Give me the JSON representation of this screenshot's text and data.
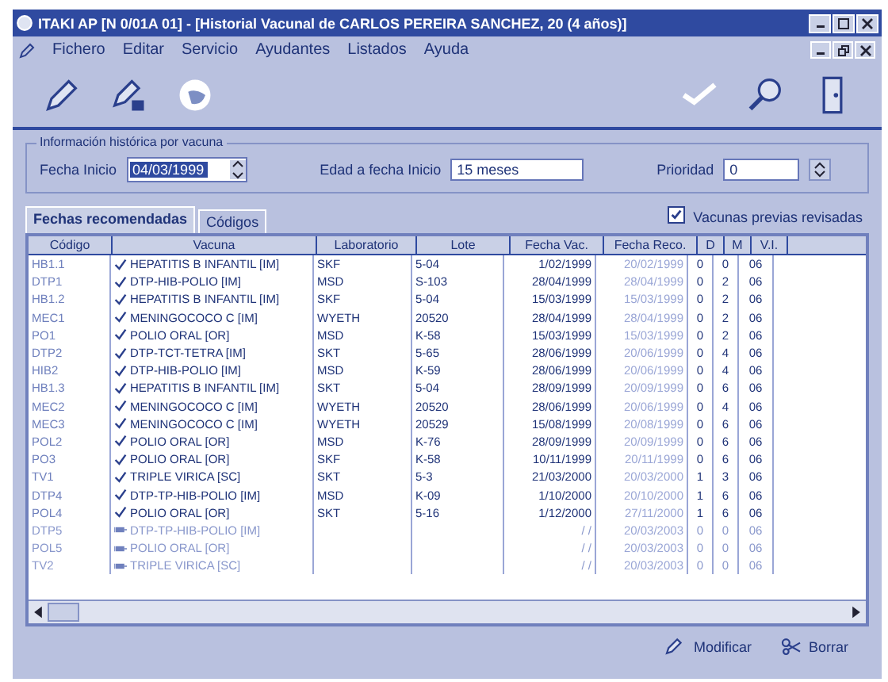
{
  "window": {
    "title": "ITAKI AP [N 0/01A 01] - [Historial Vacunal de CARLOS PEREIRA SANCHEZ, 20 (4 años)]"
  },
  "menu": [
    "Fichero",
    "Editar",
    "Servicio",
    "Ayudantes",
    "Listados",
    "Ayuda"
  ],
  "filter": {
    "title": "Información histórica por vacuna",
    "start_label": "Fecha Inicio",
    "start_value": "04/03/1999",
    "age_label": "Edad a fecha Inicio",
    "age_value": "15 meses",
    "priority_label": "Prioridad",
    "priority_value": "0"
  },
  "tabs": [
    {
      "label": "Fechas recomendadas",
      "selected": true
    },
    {
      "label": "Códigos",
      "selected": false
    }
  ],
  "reviewed": {
    "label": "Vacunas previas revisadas",
    "checked": true
  },
  "table": {
    "columns": [
      "Código",
      "Vacuna",
      "Laboratorio",
      "Lote",
      "Fecha Vac.",
      "Fecha Reco.",
      "D",
      "M",
      "V.I."
    ],
    "rows": [
      {
        "kind": "given",
        "cells": [
          "HB1.1",
          "HEPATITIS B INFANTIL [IM]",
          "SKF",
          "5-04",
          "1/02/1999",
          "20/02/1999",
          "0",
          "0",
          "06"
        ]
      },
      {
        "kind": "given",
        "cells": [
          "DTP1",
          "DTP-HIB-POLIO [IM]",
          "MSD",
          "S-103",
          "28/04/1999",
          "28/04/1999",
          "0",
          "2",
          "06"
        ]
      },
      {
        "kind": "given",
        "cells": [
          "HB1.2",
          "HEPATITIS B INFANTIL [IM]",
          "SKF",
          "5-04",
          "15/03/1999",
          "15/03/1999",
          "0",
          "2",
          "06"
        ]
      },
      {
        "kind": "given",
        "cells": [
          "MEC1",
          "MENINGOCOCO C [IM]",
          "WYETH",
          "20520",
          "28/04/1999",
          "28/04/1999",
          "0",
          "2",
          "06"
        ]
      },
      {
        "kind": "given",
        "cells": [
          "PO1",
          "POLIO ORAL [OR]",
          "MSD",
          "K-58",
          "15/03/1999",
          "15/03/1999",
          "0",
          "2",
          "06"
        ]
      },
      {
        "kind": "given",
        "cells": [
          "DTP2",
          "DTP-TCT-TETRA [IM]",
          "SKT",
          "5-65",
          "28/06/1999",
          "20/06/1999",
          "0",
          "4",
          "06"
        ]
      },
      {
        "kind": "given",
        "cells": [
          "HIB2",
          "DTP-HIB-POLIO [IM]",
          "MSD",
          "K-59",
          "28/06/1999",
          "20/06/1999",
          "0",
          "4",
          "06"
        ]
      },
      {
        "kind": "given",
        "cells": [
          "HB1.3",
          "HEPATITIS B INFANTIL [IM]",
          "SKT",
          "5-04",
          "28/09/1999",
          "20/09/1999",
          "0",
          "6",
          "06"
        ]
      },
      {
        "kind": "given",
        "cells": [
          "MEC2",
          "MENINGOCOCO C [IM]",
          "WYETH",
          "20520",
          "28/06/1999",
          "20/06/1999",
          "0",
          "4",
          "06"
        ]
      },
      {
        "kind": "given",
        "cells": [
          "MEC3",
          "MENINGOCOCO C [IM]",
          "WYETH",
          "20529",
          "15/08/1999",
          "20/08/1999",
          "0",
          "6",
          "06"
        ]
      },
      {
        "kind": "given",
        "cells": [
          "POL2",
          "POLIO ORAL [OR]",
          "MSD",
          "K-76",
          "28/09/1999",
          "20/09/1999",
          "0",
          "6",
          "06"
        ]
      },
      {
        "kind": "given",
        "cells": [
          "PO3",
          "POLIO ORAL [OR]",
          "SKF",
          "K-58",
          "10/11/1999",
          "20/11/1999",
          "0",
          "6",
          "06"
        ]
      },
      {
        "kind": "given",
        "cells": [
          "TV1",
          "TRIPLE VIRICA [SC]",
          "SKT",
          "5-3",
          "21/03/2000",
          "20/03/2000",
          "1",
          "3",
          "06"
        ]
      },
      {
        "kind": "given",
        "cells": [
          "DTP4",
          "DTP-TP-HIB-POLIO [IM]",
          "MSD",
          "K-09",
          "1/10/2000",
          "20/10/2000",
          "1",
          "6",
          "06"
        ]
      },
      {
        "kind": "given",
        "cells": [
          "POL4",
          "POLIO ORAL [OR]",
          "SKT",
          "5-16",
          "1/12/2000",
          "27/11/2000",
          "1",
          "6",
          "06"
        ]
      },
      {
        "kind": "pending",
        "cells": [
          "DTP5",
          "DTP-TP-HIB-POLIO [IM]",
          "",
          "",
          "/ /",
          "20/03/2003",
          "0",
          "0",
          "06"
        ]
      },
      {
        "kind": "pending",
        "cells": [
          "POL5",
          "POLIO ORAL [OR]",
          "",
          "",
          "/ /",
          "20/03/2003",
          "0",
          "0",
          "06"
        ]
      },
      {
        "kind": "pending",
        "cells": [
          "TV2",
          "TRIPLE VIRICA [SC]",
          "",
          "",
          "/ /",
          "20/03/2003",
          "0",
          "0",
          "06"
        ]
      }
    ]
  },
  "buttons": [
    "Modificar",
    "Borrar"
  ]
}
